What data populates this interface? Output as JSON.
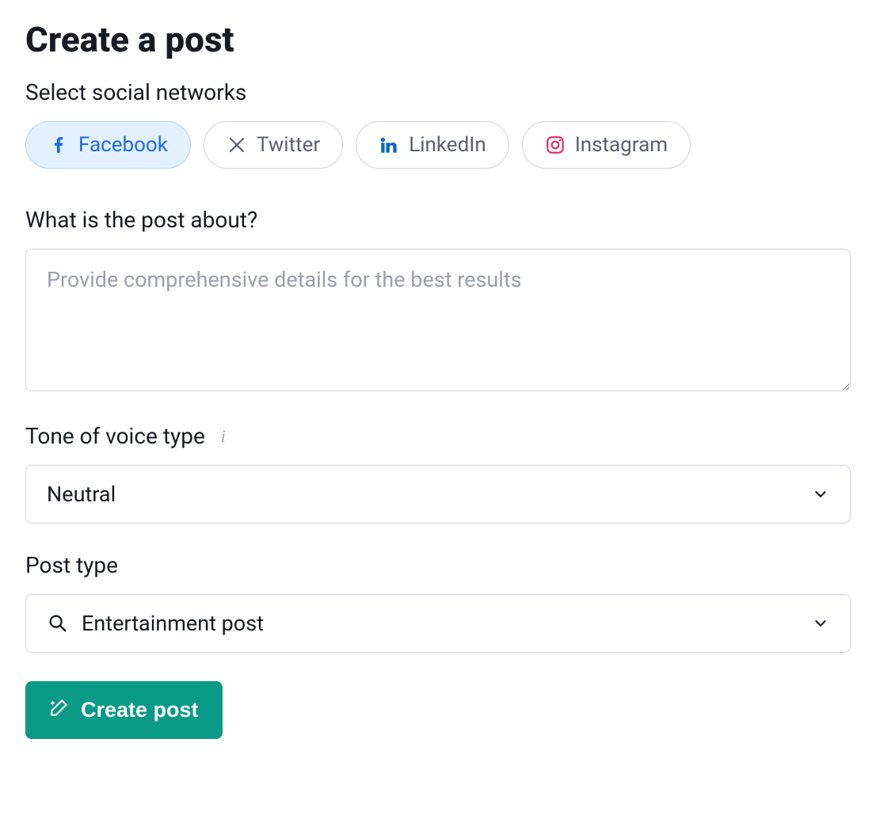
{
  "title": "Create a post",
  "networks": {
    "label": "Select social networks",
    "items": [
      {
        "name": "Facebook",
        "icon": "facebook-icon",
        "selected": true,
        "color": "#1c6ce6"
      },
      {
        "name": "Twitter",
        "icon": "x-icon",
        "selected": false,
        "color": "#596175"
      },
      {
        "name": "LinkedIn",
        "icon": "linkedin-icon",
        "selected": false,
        "color": "#0a66c2"
      },
      {
        "name": "Instagram",
        "icon": "instagram-icon",
        "selected": false,
        "color": "#e1306c"
      }
    ]
  },
  "about": {
    "label": "What is the post about?",
    "placeholder": "Provide comprehensive details for the best results",
    "value": ""
  },
  "tone": {
    "label": "Tone of voice type",
    "value": "Neutral"
  },
  "postType": {
    "label": "Post type",
    "value": "Entertainment post",
    "icon": "magnify-sparkle-icon"
  },
  "submit": {
    "label": "Create post",
    "icon": "magic-wand-icon"
  },
  "colors": {
    "accent": "#099a87",
    "selectedChipBg": "#e3f1ff",
    "border": "#cfd3de"
  }
}
